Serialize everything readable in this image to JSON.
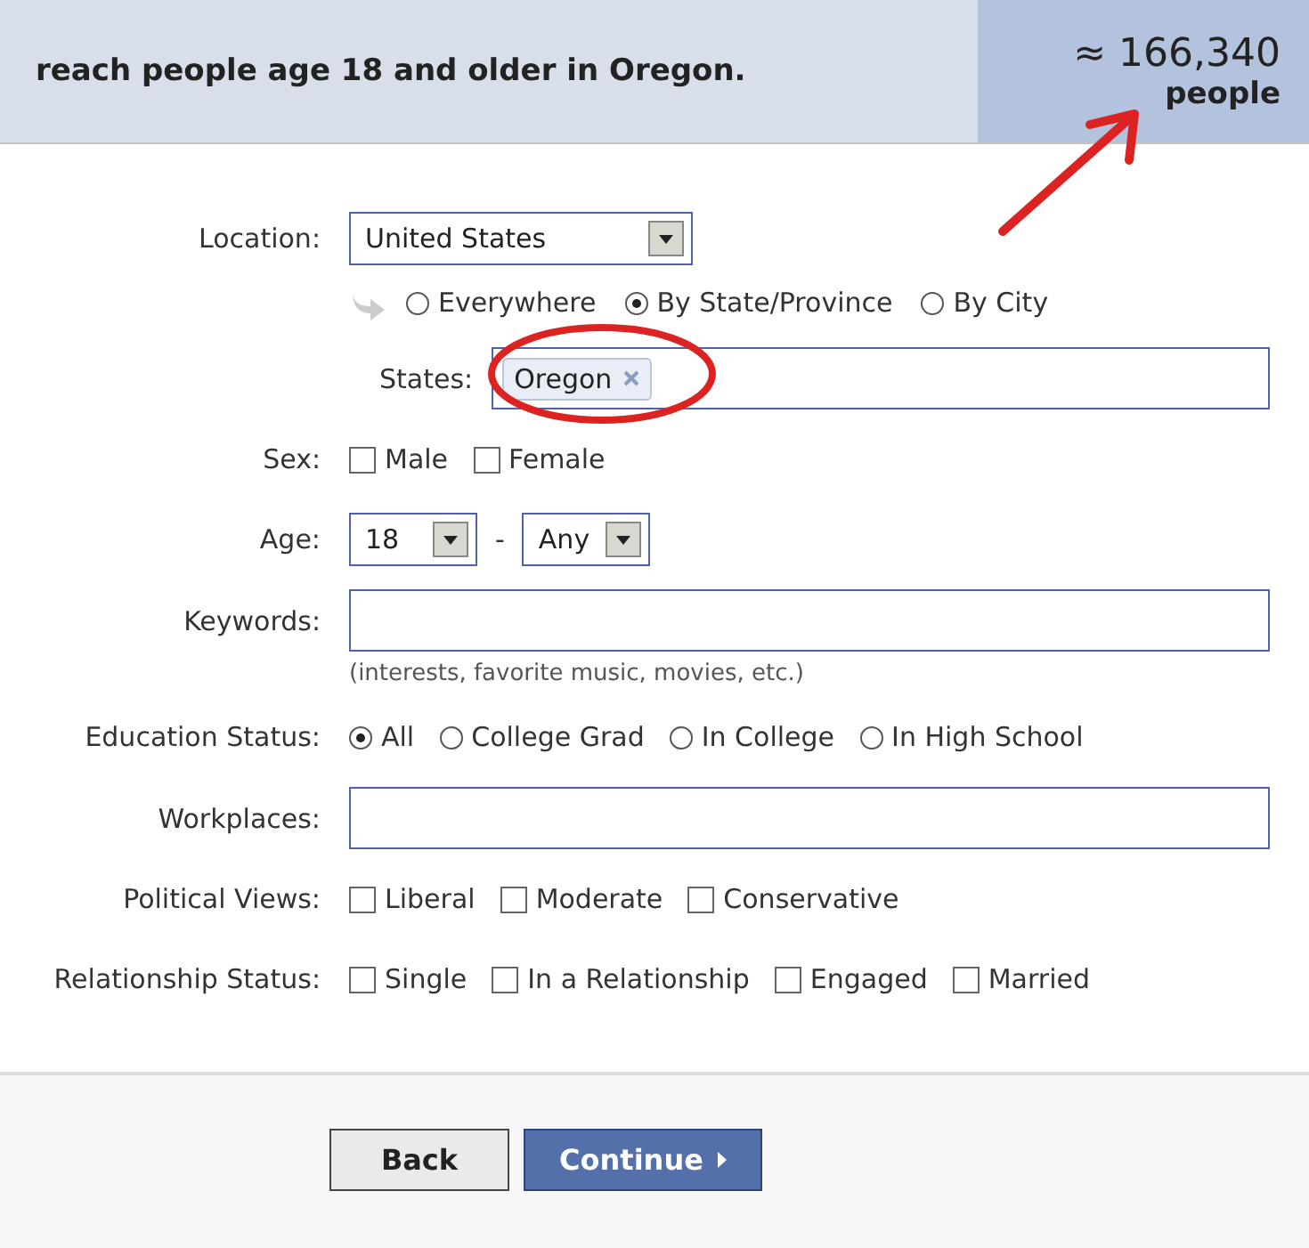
{
  "header": {
    "summary": "reach people age 18 and older in Oregon.",
    "estimate": "≈ 166,340",
    "estimate_unit": "people"
  },
  "form": [
    {
      "kind": "select",
      "label": "Location:",
      "value": "United States"
    },
    {
      "kind": "radio",
      "options": [
        {
          "label": "Everywhere",
          "selected": false
        },
        {
          "label": "By State/Province",
          "selected": true
        },
        {
          "label": "By City",
          "selected": false
        }
      ]
    },
    {
      "kind": "tokens",
      "label": "States:",
      "tokens": [
        "Oregon"
      ]
    },
    {
      "kind": "checks",
      "label": "Sex:",
      "options": [
        {
          "label": "Male",
          "checked": false
        },
        {
          "label": "Female",
          "checked": false
        }
      ]
    },
    {
      "kind": "range",
      "label": "Age:",
      "from": "18",
      "separator": "-",
      "to": "Any"
    },
    {
      "kind": "text",
      "label": "Keywords:",
      "note": "(interests, favorite music, movies, etc.)"
    },
    {
      "kind": "radio",
      "label": "Education Status:",
      "options": [
        {
          "label": "All",
          "selected": true
        },
        {
          "label": "College Grad",
          "selected": false
        },
        {
          "label": "In College",
          "selected": false
        },
        {
          "label": "In High School",
          "selected": false
        }
      ]
    },
    {
      "kind": "text",
      "label": "Workplaces:"
    },
    {
      "kind": "checks",
      "label": "Political Views:",
      "options": [
        {
          "label": "Liberal",
          "checked": false
        },
        {
          "label": "Moderate",
          "checked": false
        },
        {
          "label": "Conservative",
          "checked": false
        }
      ]
    },
    {
      "kind": "checks",
      "label": "Relationship Status:",
      "options": [
        {
          "label": "Single",
          "checked": false
        },
        {
          "label": "In a Relationship",
          "checked": false
        },
        {
          "label": "Engaged",
          "checked": false
        },
        {
          "label": "Married",
          "checked": false
        }
      ]
    }
  ],
  "buttons": [
    {
      "label": "Back",
      "kind": "secondary"
    },
    {
      "label": "Continue",
      "kind": "primary"
    }
  ]
}
